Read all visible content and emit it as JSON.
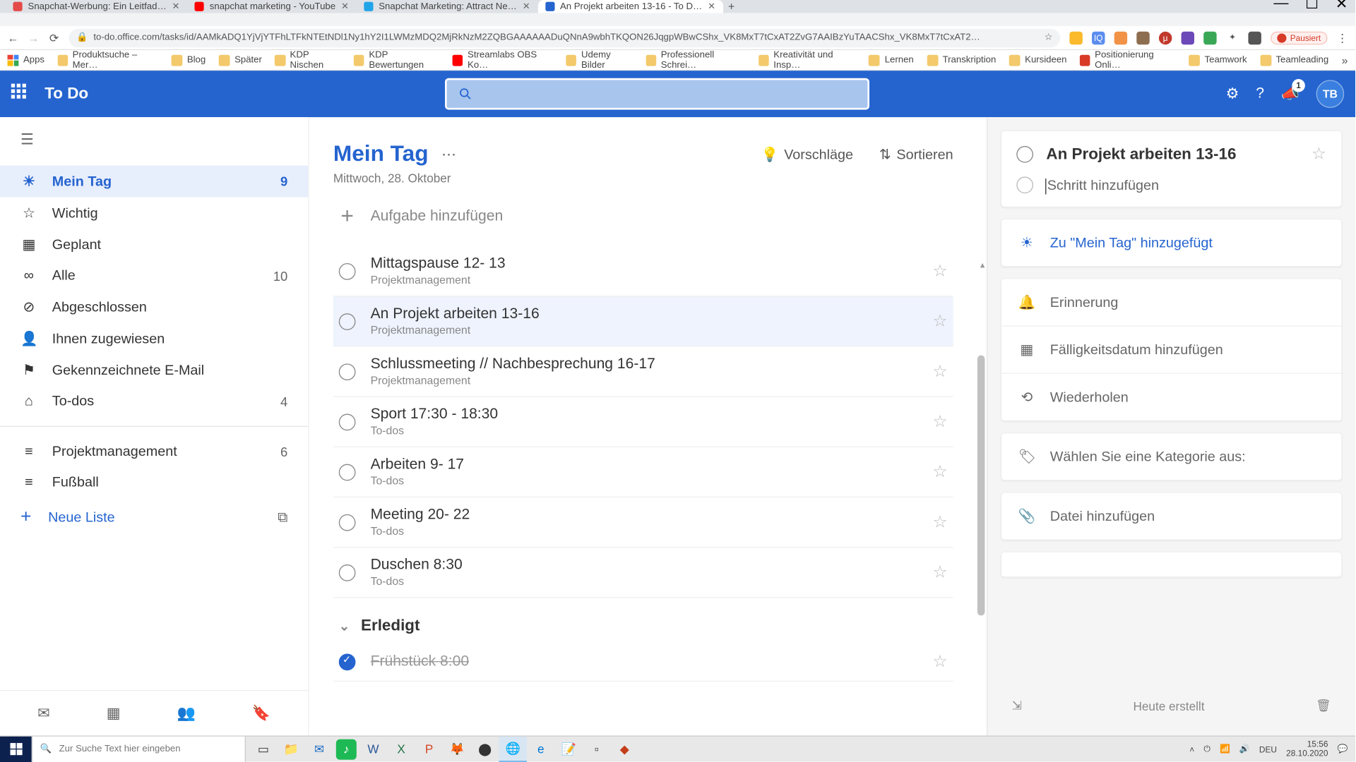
{
  "window": {
    "min": "—",
    "max": "☐",
    "close": "✕"
  },
  "tabs": [
    {
      "fav": "#e54a4a",
      "label": "Snapchat-Werbung: Ein Leitfad…"
    },
    {
      "fav": "#ff0000",
      "label": "snapchat marketing - YouTube"
    },
    {
      "fav": "#20a4e8",
      "label": "Snapchat Marketing: Attract Ne…"
    },
    {
      "fav": "#2564cf",
      "label": "An Projekt arbeiten 13-16 - To D…",
      "active": true
    }
  ],
  "addr": {
    "lock": "🔒",
    "url": "to-do.office.com/tasks/id/AAMkADQ1YjVjYTFhLTFkNTEtNDl1Ny1hY2I1LWMzMDQ2MjRkNzM2ZQBGAAAAAADuQNnA9wbhTKQON26JqgpWBwCShx_VK8MxT7tCxAT2ZvG7AAIBzYuTAACShx_VK8MxT7tCxAT2…",
    "pause": "Pausiert"
  },
  "bookmarks": [
    {
      "label": "Apps",
      "fav": "#5f6368"
    },
    {
      "label": "Produktsuche – Mer…"
    },
    {
      "label": "Blog"
    },
    {
      "label": "Später"
    },
    {
      "label": "KDP Nischen"
    },
    {
      "label": "KDP Bewertungen"
    },
    {
      "label": "Streamlabs OBS Ko…",
      "fav": "#ff0000"
    },
    {
      "label": "Udemy Bilder"
    },
    {
      "label": "Professionell Schrei…"
    },
    {
      "label": "Kreativität und Insp…"
    },
    {
      "label": "Lernen"
    },
    {
      "label": "Transkription"
    },
    {
      "label": "Kursideen"
    },
    {
      "label": "Positionierung Onli…",
      "fav": "#d73a27"
    },
    {
      "label": "Teamwork"
    },
    {
      "label": "Teamleading"
    }
  ],
  "app": {
    "title": "To Do",
    "avatar": "TB",
    "notif": "1"
  },
  "sidebar": {
    "items": [
      {
        "icon": "sun",
        "label": "Mein Tag",
        "count": "9",
        "active": true
      },
      {
        "icon": "star",
        "label": "Wichtig"
      },
      {
        "icon": "calendar",
        "label": "Geplant"
      },
      {
        "icon": "infinity",
        "label": "Alle",
        "count": "10"
      },
      {
        "icon": "check",
        "label": "Abgeschlossen"
      },
      {
        "icon": "person",
        "label": "Ihnen zugewiesen"
      },
      {
        "icon": "flag",
        "label": "Gekennzeichnete E-Mail"
      },
      {
        "icon": "home",
        "label": "To-dos",
        "count": "4"
      }
    ],
    "lists": [
      {
        "label": "Projektmanagement",
        "count": "6"
      },
      {
        "label": "Fußball"
      }
    ],
    "newlist": "Neue Liste"
  },
  "main": {
    "title": "Mein Tag",
    "date": "Mittwoch, 28. Oktober",
    "suggest": "Vorschläge",
    "sort": "Sortieren",
    "addtask": "Aufgabe hinzufügen",
    "completed_header": "Erledigt",
    "tasks": [
      {
        "title": "Mittagspause 12- 13",
        "sub": "Projektmanagement"
      },
      {
        "title": "An Projekt arbeiten 13-16",
        "sub": "Projektmanagement",
        "selected": true
      },
      {
        "title": "Schlussmeeting // Nachbesprechung 16-17",
        "sub": "Projektmanagement"
      },
      {
        "title": "Sport 17:30 - 18:30",
        "sub": "To-dos"
      },
      {
        "title": "Arbeiten 9- 17",
        "sub": "To-dos"
      },
      {
        "title": "Meeting 20- 22",
        "sub": "To-dos"
      },
      {
        "title": "Duschen 8:30",
        "sub": "To-dos"
      }
    ],
    "done_tasks": [
      {
        "title": "Frühstück 8:00"
      }
    ]
  },
  "detail": {
    "title": "An Projekt arbeiten 13-16",
    "addstep": "Schritt hinzufügen",
    "myday": "Zu \"Mein Tag\" hinzugefügt",
    "remind": "Erinnerung",
    "due": "Fälligkeitsdatum hinzufügen",
    "repeat": "Wiederholen",
    "category": "Wählen Sie eine Kategorie aus:",
    "file": "Datei hinzufügen",
    "created": "Heute erstellt"
  },
  "taskbar": {
    "search": "Zur Suche Text hier eingeben",
    "time": "15:56",
    "date": "28.10.2020",
    "lang": "DEU"
  }
}
